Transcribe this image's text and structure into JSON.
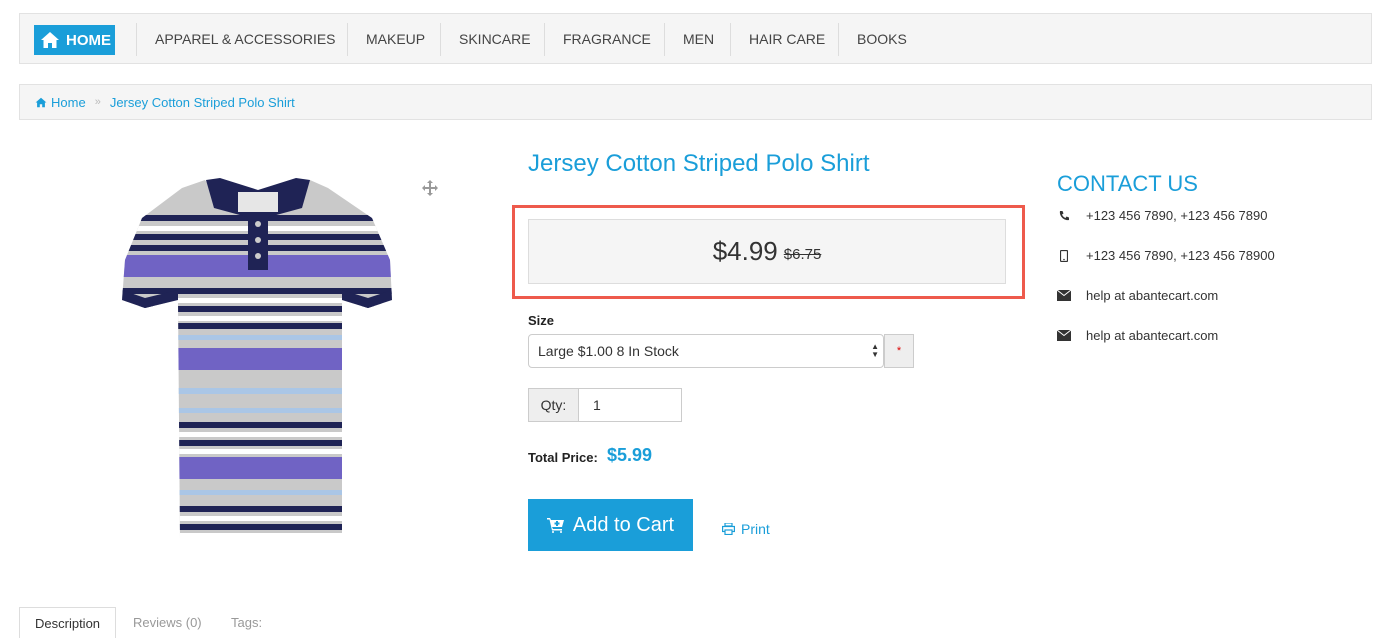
{
  "nav": {
    "home_label": "HOME",
    "items": [
      "APPAREL & ACCESSORIES",
      "MAKEUP",
      "SKINCARE",
      "FRAGRANCE",
      "MEN",
      "HAIR CARE",
      "BOOKS"
    ]
  },
  "breadcrumb": {
    "home": "Home",
    "current": "Jersey Cotton Striped Polo Shirt"
  },
  "product": {
    "title": "Jersey Cotton Striped Polo Shirt",
    "price": "$4.99",
    "old_price": "$6.75",
    "size_label": "Size",
    "size_selected": "Large $1.00 8 In Stock",
    "required_mark": "*",
    "qty_label": "Qty:",
    "qty_value": "1",
    "total_label": "Total Price:",
    "total_value": "$5.99",
    "add_to_cart": "Add to Cart",
    "print": "Print"
  },
  "contact": {
    "title": "CONTACT US",
    "phone": "+123 456 7890, +123 456 7890",
    "mobile": "+123 456 7890, +123 456 78900",
    "email1": "help at abantecart.com",
    "email2": "help at abantecart.com"
  },
  "tabs": [
    "Description",
    "Reviews (0)",
    "Tags:"
  ],
  "colors": {
    "accent": "#1a9ed9",
    "highlight": "#ee5a4c"
  }
}
